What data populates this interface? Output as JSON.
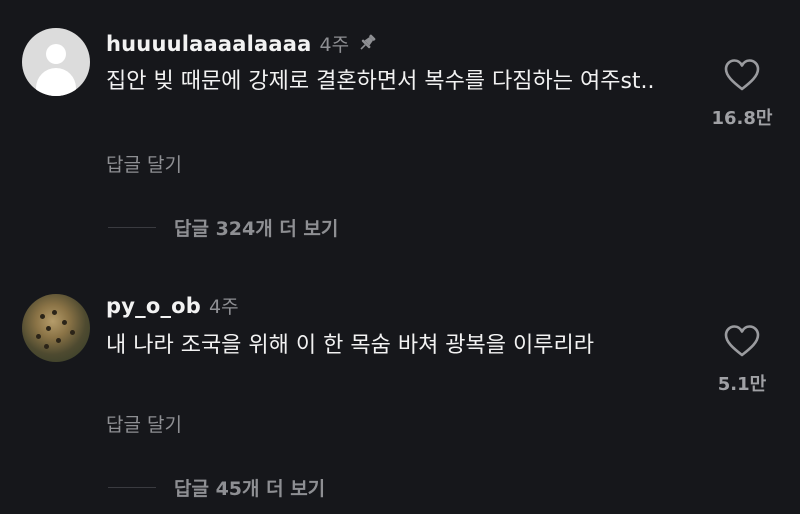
{
  "comments": [
    {
      "username": "huuuulaaaalaaaa",
      "time": "4주",
      "pinned_icon": "pin-icon",
      "text": "집안 빚 때문에 강제로 결혼하면서 복수를 다짐하는 여주st..",
      "reply_label": "답글 달기",
      "like_icon": "heart-outline-icon",
      "likes": "16.8만",
      "view_replies": "답글 324개 더 보기",
      "avatar": "default-avatar"
    },
    {
      "username": "py_o_ob",
      "time": "4주",
      "text": "내 나라 조국을 위해 이 한 목숨 바쳐 광복을 이루리라",
      "reply_label": "답글 달기",
      "like_icon": "heart-outline-icon",
      "likes": "5.1만",
      "view_replies": "답글 45개 더 보기",
      "avatar": "leopard-photo-avatar"
    }
  ],
  "colors": {
    "background": "#16171b",
    "primary_text": "#f2f2f2",
    "secondary_text": "#8e8f93"
  }
}
